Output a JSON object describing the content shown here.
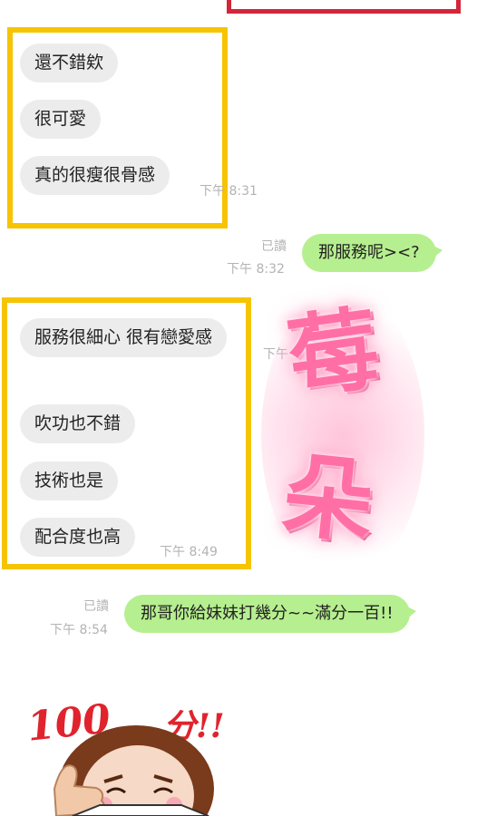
{
  "chat": {
    "group1": {
      "messages": [
        "還不錯欸",
        "很可愛",
        "真的很瘦很骨感"
      ],
      "time": "下午 8:31"
    },
    "reply1": {
      "read": "已讀",
      "time": "下午 8:32",
      "text": "那服務呢><?"
    },
    "group2": {
      "messages": [
        "服務很細心 很有戀愛感",
        "吹功也不錯",
        "技術也是",
        "配合度也高"
      ],
      "time_partial": "下午",
      "time": "下午 8:49"
    },
    "sticker_text": {
      "line1": "莓",
      "line2": "朵"
    },
    "reply2": {
      "read": "已讀",
      "time": "下午 8:54",
      "text": "那哥你給妹妹打幾分~~滿分一百!!"
    },
    "score_sticker": {
      "number": "100",
      "unit": "分!!"
    }
  },
  "colors": {
    "highlight": "#f6c400",
    "incoming_bubble": "#ececec",
    "outgoing_bubble": "#b6ef8f",
    "top_frame": "#d2263a",
    "sticker_pink": "#ff6fa5"
  }
}
